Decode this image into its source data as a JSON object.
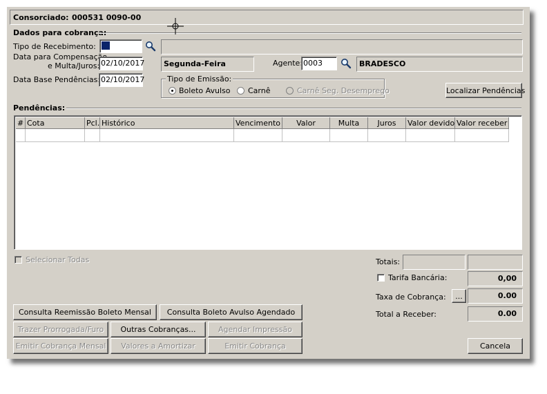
{
  "header": {
    "consorciado_label": "Consorciado:",
    "consorciado_value": "000531 0090-00"
  },
  "dados": {
    "section_title": "Dados para cobrança:",
    "tipo_recebimento_label": "Tipo de Recebimento:",
    "data_comp_label_1": "Data para Compensação",
    "data_comp_label_2": "e Multa/Juros:",
    "data_comp_value": "02/10/2017",
    "data_base_label": "Data Base Pendências:",
    "data_base_value": "02/10/2017",
    "weekday": "Segunda-Feira",
    "agente_label": "Agente:",
    "agente_value": "0003",
    "agente_name": "BRADESCO"
  },
  "emissao": {
    "title": "Tipo de Emissão:",
    "options": [
      "Boleto Avulso",
      "Carnê",
      "Carnê Seg. Desemprego"
    ],
    "selected": "Boleto Avulso"
  },
  "localizar_button": "Localizar Pendências",
  "pendencias": {
    "section_title": "Pendências:",
    "columns": [
      "#",
      "Cota",
      "Pcl.",
      "Histórico",
      "Vencimento",
      "Valor",
      "Multa",
      "Juros",
      "Valor devido",
      "Valor receber"
    ]
  },
  "selecionar_todas": "Selecionar Todas",
  "totais": {
    "totais_label": "Totais:",
    "tarifa_label": "Tarifa Bancária:",
    "tarifa_value": "0,00",
    "taxa_label": "Taxa de Cobrança:",
    "taxa_btn": "...",
    "taxa_value": "0.00",
    "total_label": "Total a Receber:",
    "total_value": "0.00"
  },
  "buttons": {
    "consulta_reemissao": "Consulta Reemissão Boleto Mensal",
    "consulta_avulso": "Consulta Boleto Avulso Agendado",
    "trazer_prorrogada": "Trazer Prorrogada/Furo",
    "outras_cobrancas": "Outras Cobranças...",
    "agendar_impressao": "Agendar Impressão",
    "emitir_mensal": "Emitir Cobrança Mensal",
    "valores_amortizar": "Valores a Amortizar",
    "emitir_cobranca": "Emitir Cobrança",
    "cancela": "Cancela"
  },
  "icons": [
    "magnifier-icon",
    "crosshair-cursor-icon"
  ]
}
